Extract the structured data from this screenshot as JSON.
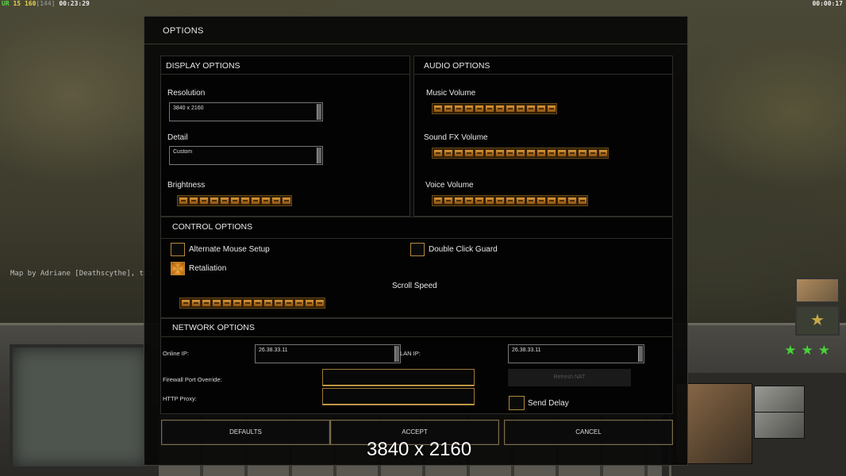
{
  "hud": {
    "left_a": "UR",
    "left_b": "15",
    "left_c": "160",
    "left_d": "[144]",
    "left_time": "00:23:29",
    "right_time": "00:00:17",
    "map_credit": "Map by Adriane [Deathscythe], tri"
  },
  "modal": {
    "title": "OPTIONS",
    "display": {
      "header": "DISPLAY OPTIONS",
      "resolution_label": "Resolution",
      "resolution_value": "3840 x 2160",
      "detail_label": "Detail",
      "detail_value": "Custom",
      "brightness_label": "Brightness",
      "brightness_level": 1.0
    },
    "audio": {
      "header": "AUDIO OPTIONS",
      "music_label": "Music Volume",
      "music_level": 1.0,
      "sfx_label": "Sound FX Volume",
      "sfx_level": 1.0,
      "voice_label": "Voice Volume",
      "voice_level": 1.0
    },
    "control": {
      "header": "CONTROL OPTIONS",
      "alternate_mouse_label": "Alternate Mouse Setup",
      "alternate_mouse_checked": false,
      "double_click_label": "Double Click Guard",
      "double_click_checked": false,
      "retaliation_label": "Retaliation",
      "retaliation_checked": true,
      "scroll_speed_label": "Scroll Speed",
      "scroll_speed_level": 1.0
    },
    "network": {
      "header": "NETWORK OPTIONS",
      "online_ip_label": "Online IP:",
      "online_ip_value": "26.38.33.11",
      "lan_ip_label": "LAN IP:",
      "lan_ip_value": "26.38.33.11",
      "firewall_label": "Firewall Port Override:",
      "firewall_value": "",
      "http_proxy_label": "HTTP Proxy:",
      "http_proxy_value": "",
      "refresh_nat_label": "Refresh NAT",
      "send_delay_label": "Send Delay",
      "send_delay_checked": false
    },
    "buttons": {
      "defaults": "DEFAULTS",
      "accept": "ACCEPT",
      "cancel": "CANCEL"
    },
    "tooltip": "3840 x 2160"
  },
  "colors": {
    "slider_fill": "#d89a3c",
    "checkbox_border": "#b38a3c",
    "accent_green": "#58d64a"
  }
}
